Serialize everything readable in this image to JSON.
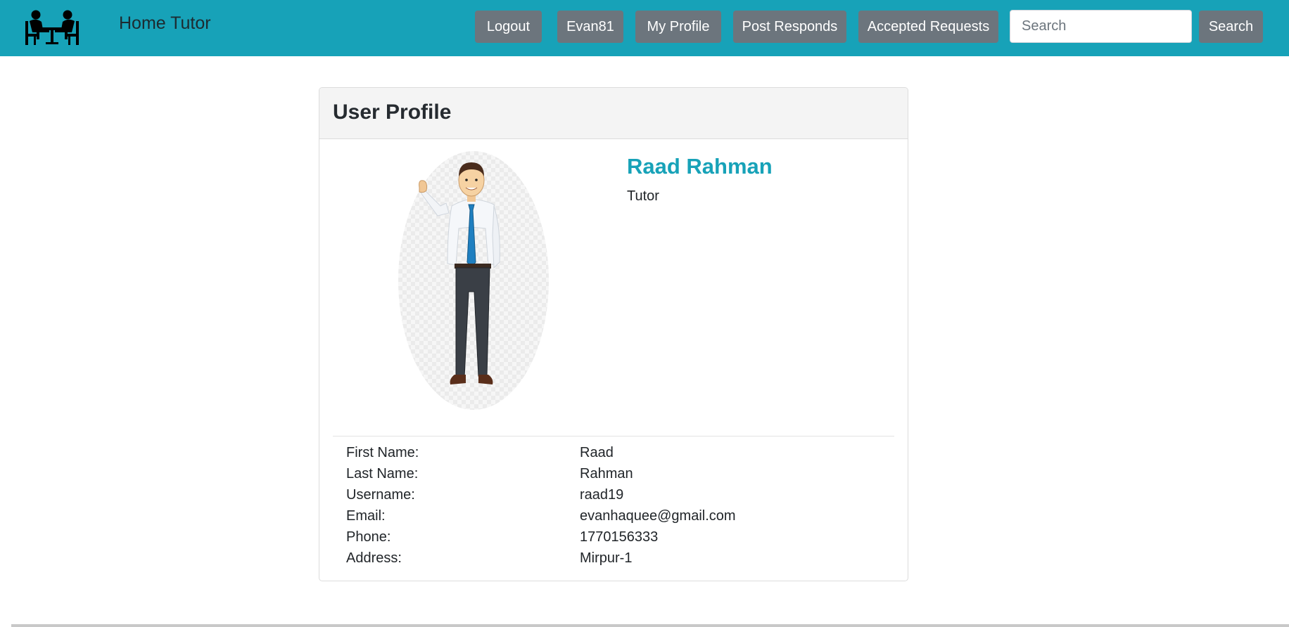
{
  "app": {
    "brand": "Home Tutor",
    "logo_icon": "tutor-students-table-icon"
  },
  "nav": {
    "buttons": [
      {
        "label": "Logout"
      },
      {
        "label": "Evan81"
      },
      {
        "label": "My Profile"
      },
      {
        "label": "Post Responds"
      },
      {
        "label": "Accepted Requests"
      }
    ],
    "search": {
      "placeholder": "Search",
      "value": "",
      "button_label": "Search"
    }
  },
  "profile_card": {
    "title": "User Profile",
    "name": "Raad Rahman",
    "role": "Tutor",
    "avatar_icon": "man-waving-avatar-icon",
    "details": [
      {
        "label": "First Name:",
        "value": "Raad"
      },
      {
        "label": "Last Name:",
        "value": "Rahman"
      },
      {
        "label": "Username:",
        "value": "raad19"
      },
      {
        "label": "Email:",
        "value": "evanhaquee@gmail.com"
      },
      {
        "label": "Phone:",
        "value": "1770156333"
      },
      {
        "label": "Address:",
        "value": "Mirpur-1"
      }
    ]
  },
  "colors": {
    "navbar": "#17a2b8",
    "button": "#6c757d",
    "name_accent": "#17a2b8",
    "card_header": "#f4f4f4"
  }
}
